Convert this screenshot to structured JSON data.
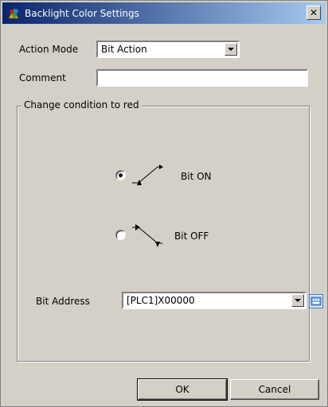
{
  "window": {
    "title": "Backlight Color Settings",
    "close_label": "✕"
  },
  "action_mode": {
    "label": "Action Mode",
    "value": "Bit Action"
  },
  "comment": {
    "label": "Comment",
    "value": ""
  },
  "group": {
    "title": "Change condition to red"
  },
  "options": {
    "bit_on": {
      "label": "Bit ON",
      "checked": true
    },
    "bit_off": {
      "label": "Bit OFF",
      "checked": false
    }
  },
  "bit_address": {
    "label": "Bit Address",
    "value": "[PLC1]X00000"
  },
  "buttons": {
    "ok": "OK",
    "cancel": "Cancel"
  },
  "colors": {
    "title_start": "#0a246a",
    "title_end": "#a6caf0",
    "face": "#d4d0c8"
  },
  "icons": {
    "title": "palette-icon",
    "bit_on": "rising-edge-icon",
    "bit_off": "falling-edge-icon",
    "address_picker": "keypad-icon"
  }
}
